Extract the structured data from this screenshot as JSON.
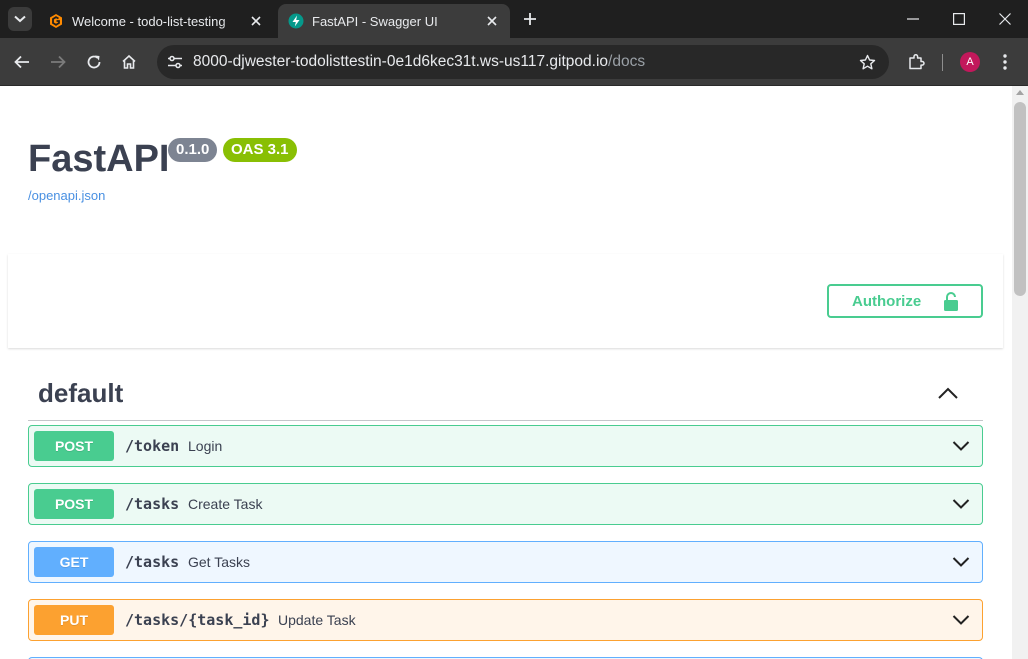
{
  "browser": {
    "tabs": [
      {
        "title": "Welcome - todo-list-testing",
        "active": false
      },
      {
        "title": "FastAPI - Swagger UI",
        "active": true
      }
    ],
    "url_host": "8000-djwester-todolisttestin-0e1d6kec31t.ws-us117.gitpod.io",
    "url_path": "/docs",
    "profile_initial": "A"
  },
  "info": {
    "title": "FastAPI",
    "version": "0.1.0",
    "oas": "OAS 3.1",
    "spec_link": "/openapi.json"
  },
  "auth": {
    "label": "Authorize"
  },
  "tag": {
    "name": "default"
  },
  "operations": [
    {
      "method": "POST",
      "path": "/token",
      "summary": "Login"
    },
    {
      "method": "POST",
      "path": "/tasks",
      "summary": "Create Task"
    },
    {
      "method": "GET",
      "path": "/tasks",
      "summary": "Get Tasks"
    },
    {
      "method": "PUT",
      "path": "/tasks/{task_id}",
      "summary": "Update Task"
    }
  ],
  "colors": {
    "post": "#49cc90",
    "get": "#61affe",
    "put": "#fca130",
    "title": "#3b4151",
    "link": "#4990e2"
  }
}
